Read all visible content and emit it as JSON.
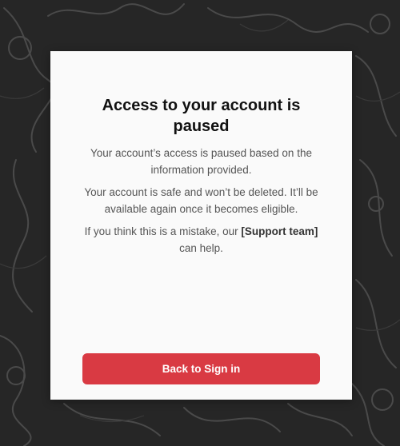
{
  "theme": {
    "background": "#262626",
    "card_background": "#fafafa",
    "button_color": "#d93a43"
  },
  "dialog": {
    "title": "Access to your account is paused",
    "message_1": "Your account’s access is paused based on the information provided.",
    "message_2": "Your account is safe and won’t be deleted. It’ll be available again once it becomes eligible.",
    "message_3_prefix": "If you think this is a mistake, our ",
    "support_link": "[Support team]",
    "message_3_suffix": " can help.",
    "button_label": "Back to Sign in"
  }
}
